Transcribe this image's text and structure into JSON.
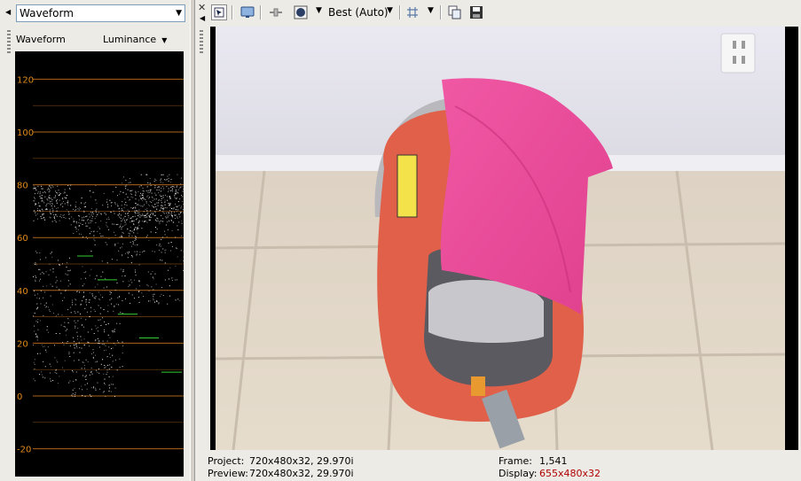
{
  "scope": {
    "selected": "Waveform",
    "label": "Waveform",
    "mode": "Luminance",
    "ticks": [
      "120",
      "100",
      "80",
      "60",
      "40",
      "20",
      "0",
      "-20"
    ],
    "colors": {
      "tick": "#e08a1a",
      "grid": "#c07020",
      "trace": "#ffffff",
      "marker": "#33cc33"
    }
  },
  "toolbar": {
    "quality": "Best (Auto)",
    "icons": [
      "close-icon",
      "video-preview-icon",
      "split-screen-icon",
      "overlay-icon",
      "quality-icon",
      "grid-icon",
      "copy-snapshot-icon",
      "save-snapshot-icon"
    ]
  },
  "status": {
    "project_label": "Project:",
    "project_value": "720x480x32, 29.970i",
    "preview_label": "Preview:",
    "preview_value": "720x480x32, 29.970i",
    "frame_label": "Frame:",
    "frame_value": "1,541",
    "display_label": "Display:",
    "display_value": "655x480x32",
    "display_color": "#b00000"
  }
}
